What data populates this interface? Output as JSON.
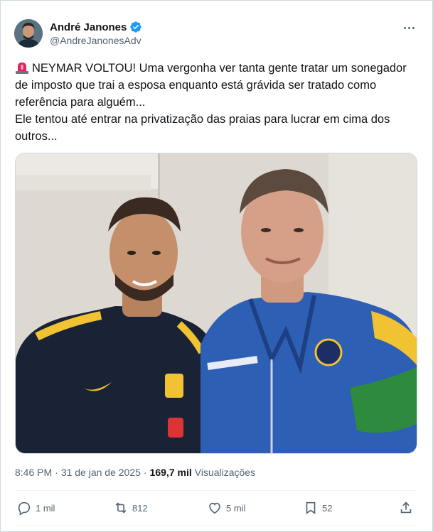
{
  "author": {
    "name": "André Janones",
    "handle": "@AndreJanonesAdv",
    "verified": true
  },
  "tweet": {
    "emoji": "siren-icon",
    "line1": "NEYMAR VOLTOU! Uma vergonha ver tanta gente tratar um sonegador de imposto que trai a esposa enquanto está grávida ser tratado como referência para alguém...",
    "line2": "Ele tentou até entrar na privatização das praias para lucrar em cima dos outros..."
  },
  "meta": {
    "time": "8:46 PM",
    "separator": "·",
    "date": "31 de jan de 2025",
    "views_count": "169,7 mil",
    "views_label": "Visualizações"
  },
  "actions": {
    "reply_count": "1 mil",
    "retweet_count": "812",
    "like_count": "5 mil",
    "bookmark_count": "52"
  },
  "colors": {
    "text_primary": "#0f1419",
    "text_secondary": "#536471",
    "verified": "#1d9bf0",
    "border": "#cfd9de"
  }
}
